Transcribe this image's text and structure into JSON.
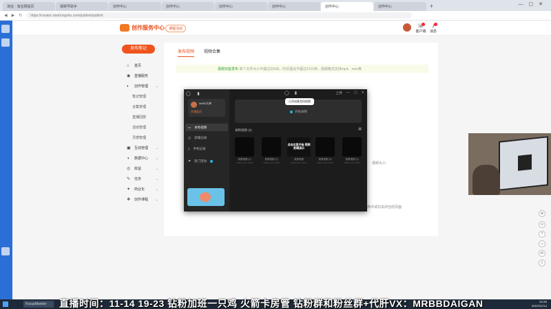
{
  "browser": {
    "tabs": [
      {
        "label": "淘宝 - 淘宝网首页"
      },
      {
        "label": "视频号助手"
      },
      {
        "label": "创作中心"
      },
      {
        "label": "创作中心"
      },
      {
        "label": "创作中心"
      },
      {
        "label": "创作中心"
      },
      {
        "label": "创作中心"
      },
      {
        "label": "创作中心"
      }
    ],
    "url": "https://creator.xiaohongshu.com/publish/publish"
  },
  "header": {
    "logo_text": "创作服务中心",
    "badge": "课程活动",
    "icons": [
      {
        "name": "customer-service-icon",
        "label": "客户端"
      },
      {
        "name": "notification-icon",
        "label": "消息"
      }
    ]
  },
  "sidebar": {
    "publish_label": "发布笔记",
    "items": [
      {
        "icon": "⌂",
        "label": "首页",
        "sub": false,
        "caret": false
      },
      {
        "icon": "◉",
        "label": "直播服务",
        "sub": false,
        "caret": false
      },
      {
        "icon": "◐",
        "label": "创作管理",
        "sub": false,
        "caret": true
      },
      {
        "label": "笔记管理",
        "sub": true
      },
      {
        "label": "合集管理",
        "sub": true
      },
      {
        "label": "直播回放",
        "sub": true
      },
      {
        "label": "活动管理",
        "sub": true
      },
      {
        "label": "灵感管理",
        "sub": true
      },
      {
        "icon": "▣",
        "label": "互动管理",
        "sub": false,
        "caret": true
      },
      {
        "icon": "◑",
        "label": "数据中心",
        "sub": false,
        "caret": true
      },
      {
        "icon": "◎",
        "label": "收益",
        "sub": false,
        "caret": true
      },
      {
        "icon": "✎",
        "label": "任务",
        "sub": false,
        "caret": true
      },
      {
        "icon": "✦",
        "label": "商业化",
        "sub": false,
        "caret": true
      },
      {
        "icon": "❖",
        "label": "创作课程",
        "sub": false,
        "caret": true
      }
    ]
  },
  "main": {
    "tabs": [
      {
        "label": "发布视频"
      },
      {
        "label": "视频合集"
      }
    ],
    "notice_lead": "视频仅能发布",
    "notice_body": "单个文件大小不超过20GB，时长建议不超过15分钟，视频格式支持mp4、mov等",
    "side_label": "视频大小",
    "footer_note": "上传中请勿关闭当前页面"
  },
  "app": {
    "title_icons": "◯ ▮",
    "titlebar": [
      "上传",
      "—",
      "▢",
      "✕"
    ],
    "mic_tooltip": "已开启麦克风权限",
    "user_name": "MrBB大神",
    "user_sub": "开通会员",
    "nav": [
      {
        "label": "本地视频",
        "icon": "▭",
        "selected": true
      },
      {
        "label": "剪辑记录",
        "icon": "◫",
        "selected": false
      },
      {
        "label": "手机记录",
        "icon": "▯",
        "selected": false
      },
      {
        "label": "热门活动",
        "icon": "⚑",
        "selected": false
      }
    ],
    "start_label": "开始录制",
    "section_label": "录制视频 (5)",
    "thumbs": [
      {
        "name": "录屏视频 (1)",
        "meta": "2023-11-14 19:28"
      },
      {
        "name": "录屏视频 (2)",
        "meta": "2023-11-14 19:30"
      },
      {
        "name": "录屏视频",
        "meta": "2023-11-14 19:31",
        "overlay": "点击这里开始 视频剪辑演示"
      },
      {
        "name": "录屏视频 (3)",
        "meta": "2023-11-14 19:32"
      },
      {
        "name": "录屏视频 (4)",
        "meta": "2023-11-14 19:33"
      }
    ]
  },
  "floating": [
    "⊕",
    "⊙",
    "?",
    "☺",
    "✉",
    "⇪"
  ],
  "ticker": "直播时间：11-14 19-23 钻粉加班一只鸡 火箭卡房管 钻粉群和粉丝群+代肝VX：MRBBDAIGAN",
  "taskbar": {
    "app_label": "FocusMonitor",
    "time": "19:28",
    "date": "2023/11/14"
  }
}
